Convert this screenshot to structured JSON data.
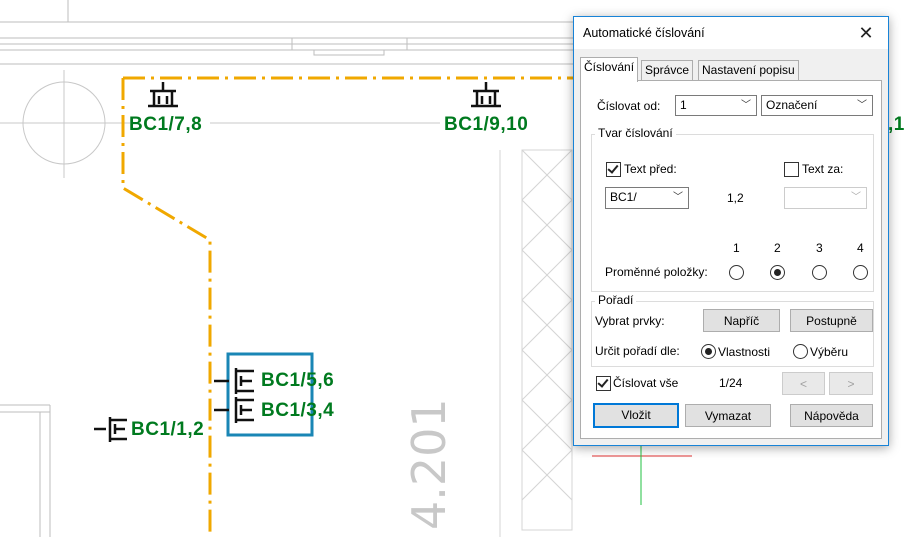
{
  "drawing": {
    "labels": {
      "bc1_78": "BC1/7,8",
      "bc1_910": "BC1/9,10",
      "bc1_partial": ",1",
      "bc1_56": "BC1/5,6",
      "bc1_34": "BC1/3,4",
      "bc1_12": "BC1/1,2"
    },
    "room_number": "4.201",
    "colors": {
      "label_green": "#007a1f",
      "wall_orange": "#f0a800",
      "selection_blue": "#1a86b5"
    }
  },
  "dialog": {
    "title": "Automatické číslování",
    "close_icon": "close-icon",
    "tabs": [
      "Číslování",
      "Správce",
      "Nastavení popisu"
    ],
    "active_tab": "Číslování",
    "number_from_label": "Číslovat od:",
    "number_from_value": "1",
    "designation_value": "Označení",
    "form_group_label": "Tvar číslování",
    "text_before_label": "Text před:",
    "text_before_checked": true,
    "text_after_label": "Text za:",
    "text_after_checked": false,
    "prefix_value": "BC1/",
    "preview_value": "1,2",
    "suffix_value": "",
    "variable_items_label": "Proměnné položky:",
    "variable_items": [
      "1",
      "2",
      "3",
      "4"
    ],
    "variable_selected": "2",
    "order_group_label": "Pořadí",
    "select_items_label": "Vybrat prvky:",
    "across_button": "Napříč",
    "gradually_button": "Postupně",
    "order_by_label": "Určit pořadí dle:",
    "order_properties": "Vlastnosti",
    "order_selection": "Výběru",
    "order_selected": "Vlastnosti",
    "number_all_label": "Číslovat vše",
    "number_all_checked": true,
    "counter": "1/24",
    "prev_button": "<",
    "next_button": ">",
    "insert_button": "Vložit",
    "delete_button": "Vymazat",
    "help_button": "Nápověda"
  }
}
